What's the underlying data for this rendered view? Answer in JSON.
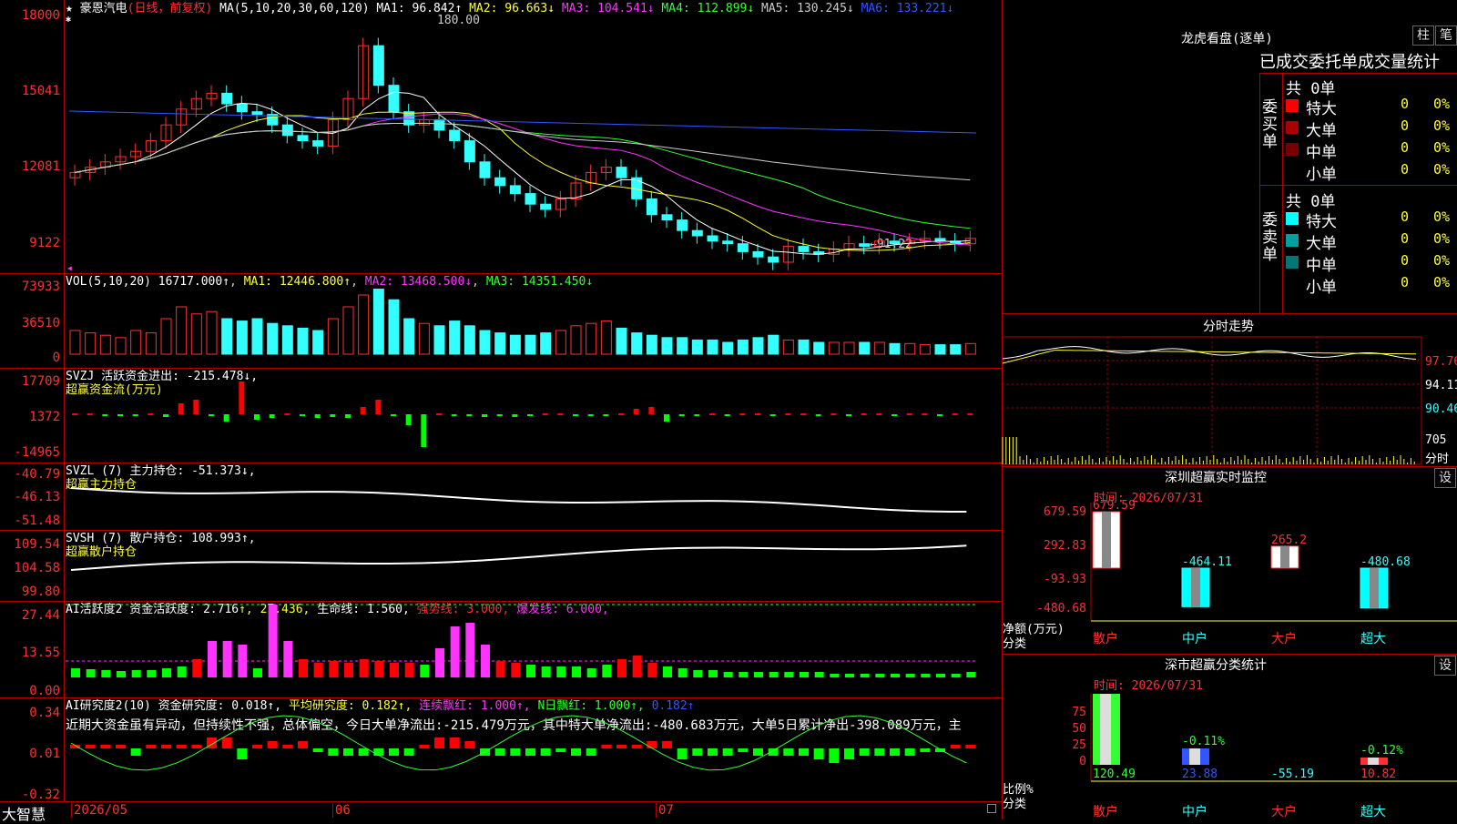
{
  "stock": {
    "name": "豪恩汽电",
    "period": "(日线，前复权)",
    "ma_label": "MA(5,10,20,30,60,120)",
    "ma": [
      {
        "label": "MA1:",
        "value": "96.842↑",
        "color": "#ffffff"
      },
      {
        "label": "MA2:",
        "value": "96.663↓",
        "color": "#ffff33"
      },
      {
        "label": "MA3:",
        "value": "104.541↓",
        "color": "#ff33ff"
      },
      {
        "label": "MA4:",
        "value": "112.899↓",
        "color": "#33ff33"
      },
      {
        "label": "MA5:",
        "value": "130.245↓",
        "color": "#cccccc"
      },
      {
        "label": "MA6:",
        "value": "133.221↓",
        "color": "#3355ff"
      }
    ],
    "y_labels": [
      "18000",
      "15041",
      "12081",
      "9122"
    ],
    "high_note": "180.00",
    "low_note": "←91.22"
  },
  "vol": {
    "header": "VOL(5,10,20)",
    "value": "16717.000↑",
    "ma1": "MA1: 12446.800↑",
    "ma2": "MA2: 13468.500↓",
    "ma3": "MA3: 14351.450↓",
    "y_labels": [
      "73933",
      "36510",
      "0"
    ]
  },
  "svzj": {
    "header": "SVZJ  活跃资金进出: -215.478↓,",
    "sub": "超赢资金流(万元)",
    "y_labels": [
      "17709",
      "1372",
      "-14965"
    ]
  },
  "svzl": {
    "header": "SVZL (7) 主力持仓: -51.373↓,",
    "sub": "超赢主力持仓",
    "y_labels": [
      "-40.79",
      "-46.13",
      "-51.48"
    ]
  },
  "svsh": {
    "header": "SVSH (7) 散户持仓: 108.993↑,",
    "sub": "超赢散户持仓",
    "y_labels": [
      "109.54",
      "104.58",
      "99.80"
    ]
  },
  "ai1": {
    "header": "AI活跃度2 资金活跃度: 2.716",
    "v2": "↑, 27.436,",
    "v3": "生命线: 1.560,",
    "v4": "强势线: 3.000,",
    "v5": "爆发线: 6.000,",
    "y_labels": [
      "27.44",
      "13.55",
      "0.00"
    ]
  },
  "ai2": {
    "header": "AI研究度2(10) 资金研究度: 0.018↑,",
    "v2": "平均研究度: 0.182↑,",
    "v3": "连续飘红: 1.000↑,",
    "v4": "N日飘红: 1.000↑,",
    "v5": "0.182↑",
    "comment": "近期大资金虽有异动，但持续性不强，总体偏空，今日大单净流出:-215.479万元，其中特大单净流出:-480.683万元，大单5日累计净出-398.089万元，主",
    "y_labels": [
      "0.34",
      "0.01",
      "-0.32"
    ]
  },
  "xaxis": {
    "brand": "大智慧",
    "labels": [
      "2026/05",
      "06",
      "07"
    ]
  },
  "lhb": {
    "title": "龙虎看盘(逐单)",
    "btn1": "柱",
    "btn2": "笔",
    "tabs": "已成交委托单成交量统计",
    "buy_side": "委买单",
    "sell_side": "委卖单",
    "buy_total": "共 0单",
    "sell_total": "共 0单",
    "buy_rows": [
      {
        "label": "特大",
        "count": "0",
        "pct": "0%",
        "color": "#ff0000"
      },
      {
        "label": "大单",
        "count": "0",
        "pct": "0%",
        "color": "#aa0000"
      },
      {
        "label": "中单",
        "count": "0",
        "pct": "0%",
        "color": "#770000"
      },
      {
        "label": "小单",
        "count": "0",
        "pct": "0%",
        "color": "#000000"
      }
    ],
    "sell_rows": [
      {
        "label": "特大",
        "count": "0",
        "pct": "0%",
        "color": "#00ffff"
      },
      {
        "label": "大单",
        "count": "0",
        "pct": "0%",
        "color": "#00a0a0"
      },
      {
        "label": "中单",
        "count": "0",
        "pct": "0%",
        "color": "#007777"
      },
      {
        "label": "小单",
        "count": "0",
        "pct": "0%",
        "color": "#000000"
      }
    ]
  },
  "intraday": {
    "title": "分时走势",
    "y_labels": [
      "97.76",
      "94.11",
      "90.46"
    ],
    "vol_label": "705",
    "vol_unit": "分时"
  },
  "sz_monitor": {
    "title": "深圳超赢实时监控",
    "btn": "设",
    "time": "时间: 2026/07/31",
    "y_labels": [
      "679.59",
      "292.83",
      "-93.93",
      "-480.68"
    ],
    "axis_title": "净额(万元)",
    "axis_title2": "分类",
    "bars": [
      {
        "cat": "散户",
        "value": "679.59"
      },
      {
        "cat": "中户",
        "value": "-464.11"
      },
      {
        "cat": "大户",
        "value": "265.2"
      },
      {
        "cat": "超大",
        "value": "-480.68"
      }
    ]
  },
  "sz_class": {
    "title": "深市超赢分类统计",
    "btn": "设",
    "time": "时间: 2026/07/31",
    "y_labels": [
      "75",
      "50",
      "25",
      "0"
    ],
    "axis_title": "比例%",
    "axis_title2": "分类",
    "bars": [
      {
        "cat": "散户",
        "value": "120.49",
        "note": ""
      },
      {
        "cat": "中户",
        "value": "23.88",
        "note": "-0.11%"
      },
      {
        "cat": "大户",
        "value": "-55.19",
        "note": ""
      },
      {
        "cat": "超大",
        "value": "10.82",
        "note": "-0.12%"
      }
    ]
  }
}
